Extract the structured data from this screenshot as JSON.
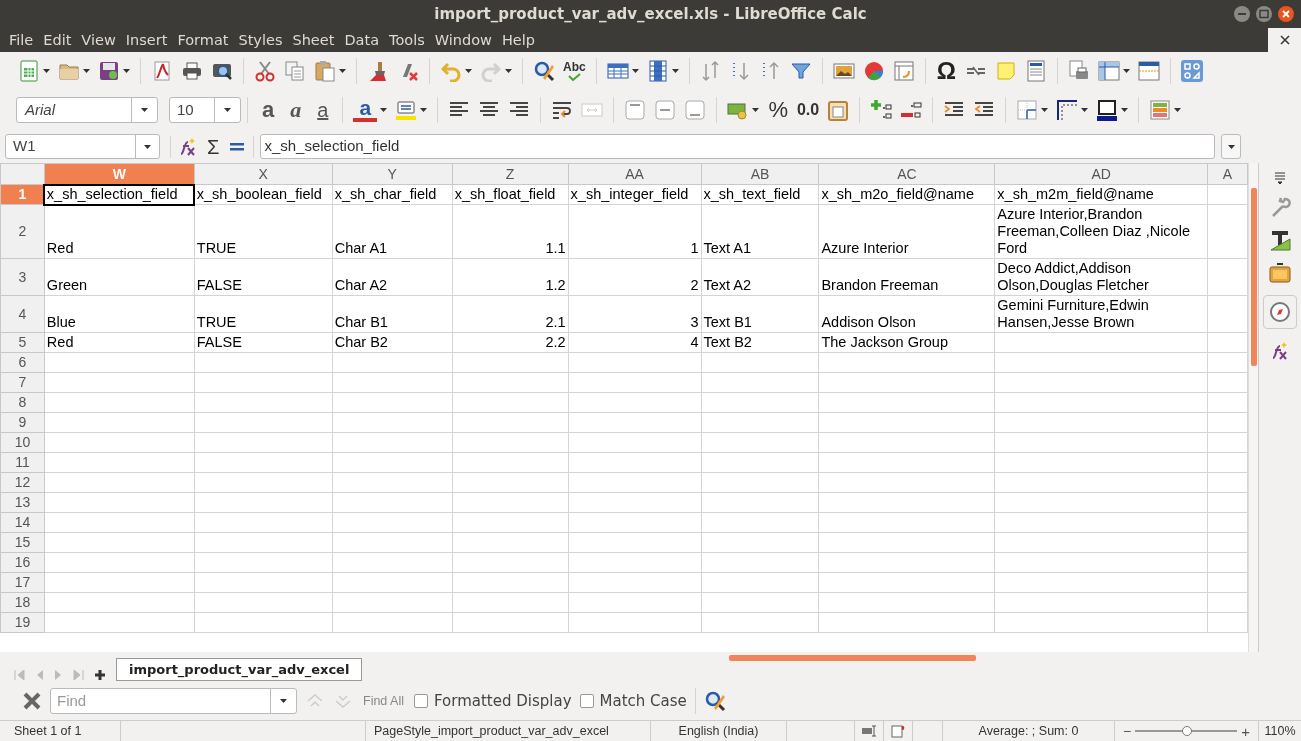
{
  "window": {
    "title": "import_product_var_adv_excel.xls - LibreOffice Calc"
  },
  "menu": [
    "File",
    "Edit",
    "View",
    "Insert",
    "Format",
    "Styles",
    "Sheet",
    "Data",
    "Tools",
    "Window",
    "Help"
  ],
  "standard_toolbar": {
    "spelling_label": "Abc",
    "special_character_label": "Ω"
  },
  "formatting_toolbar": {
    "font_name": "Arial",
    "font_size": "10",
    "bold_label": "a",
    "italic_label": "a",
    "underline_label": "a",
    "font_color_label": "a",
    "percent_label": "%",
    "decimal_label": "0.0"
  },
  "formula_bar": {
    "name_box": "W1",
    "sum_label": "Σ",
    "content": "x_sh_selection_field"
  },
  "sheet": {
    "columns": [
      {
        "header": "W",
        "kind": "text",
        "selected": true
      },
      {
        "header": "X",
        "kind": "text",
        "selected": false
      },
      {
        "header": "Y",
        "kind": "text",
        "selected": false
      },
      {
        "header": "Z",
        "kind": "number",
        "selected": false
      },
      {
        "header": "AA",
        "kind": "number",
        "selected": false
      },
      {
        "header": "AB",
        "kind": "text",
        "selected": false
      },
      {
        "header": "AC",
        "kind": "text",
        "selected": false
      },
      {
        "header": "AD",
        "kind": "text",
        "selected": false
      },
      {
        "header": "A",
        "kind": "text",
        "selected": false
      }
    ],
    "rows": [
      {
        "header": "1",
        "kind": "heading",
        "selected": true,
        "cells": [
          "x_sh_selection_field",
          "x_sh_boolean_field",
          "x_sh_char_field",
          "x_sh_float_field",
          "x_sh_integer_field",
          "x_sh_text_field",
          "x_sh_m2o_field@name",
          "x_sh_m2m_field@name"
        ]
      },
      {
        "header": "2",
        "kind": "data",
        "selected": false,
        "cells": [
          "Red",
          "TRUE",
          "Char A1",
          "1.1",
          "1",
          "Text A1",
          "Azure Interior",
          "Azure Interior,Brandon Freeman,Colleen Diaz ,Nicole Ford"
        ]
      },
      {
        "header": "3",
        "kind": "data",
        "selected": false,
        "cells": [
          "Green",
          "FALSE",
          "Char A2",
          "1.2",
          "2",
          "Text A2",
          "Brandon Freeman",
          "Deco Addict,Addison Olson,Douglas Fletcher"
        ]
      },
      {
        "header": "4",
        "kind": "data",
        "selected": false,
        "cells": [
          "Blue",
          "TRUE",
          "Char B1",
          "2.1",
          "3",
          "Text B1",
          "Addison Olson",
          "Gemini Furniture,Edwin Hansen,Jesse Brown"
        ]
      },
      {
        "header": "5",
        "kind": "data",
        "selected": false,
        "cells": [
          "Red",
          "FALSE",
          "Char B2",
          "2.2",
          "4",
          "Text B2",
          "The Jackson Group"
        ]
      },
      {
        "header": "6",
        "kind": "data",
        "selected": false
      },
      {
        "header": "7",
        "kind": "data",
        "selected": false
      },
      {
        "header": "8",
        "kind": "data",
        "selected": false
      },
      {
        "header": "9",
        "kind": "data",
        "selected": false
      },
      {
        "header": "10",
        "kind": "data",
        "selected": false
      },
      {
        "header": "11",
        "kind": "data",
        "selected": false
      },
      {
        "header": "12",
        "kind": "data",
        "selected": false
      },
      {
        "header": "13",
        "kind": "data",
        "selected": false
      },
      {
        "header": "14",
        "kind": "data",
        "selected": false
      },
      {
        "header": "15",
        "kind": "data",
        "selected": false
      },
      {
        "header": "16",
        "kind": "data",
        "selected": false
      },
      {
        "header": "17",
        "kind": "data",
        "selected": false
      },
      {
        "header": "18",
        "kind": "data",
        "selected": false
      },
      {
        "header": "19",
        "kind": "data",
        "selected": false
      }
    ]
  },
  "sheet_tabs": [
    {
      "label": "import_product_var_adv_excel",
      "selected": true
    }
  ],
  "find_bar": {
    "placeholder": "Find",
    "find_all": "Find All",
    "options": [
      {
        "label": "Formatted Display",
        "checked": false
      },
      {
        "label": "Match Case",
        "checked": false
      }
    ]
  },
  "status_bar": {
    "sheet": "Sheet 1 of 1",
    "page_style": "PageStyle_import_product_var_adv_excel",
    "language": "English (India)",
    "selection_summary": "Average: ; Sum: 0",
    "zoom_out": "−",
    "zoom_in": "+",
    "zoom": {
      "level": 0.51
    },
    "zoom_percent": "110%"
  }
}
